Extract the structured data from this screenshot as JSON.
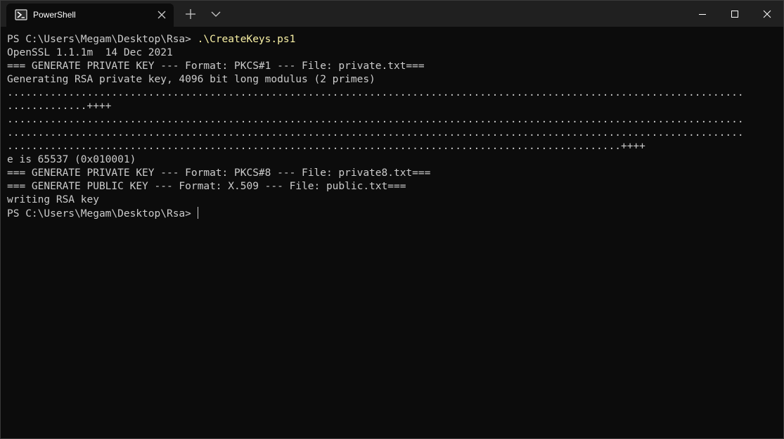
{
  "tab": {
    "icon": "powershell-icon",
    "title": "PowerShell",
    "close_icon": "close-icon"
  },
  "toolbar": {
    "new_tab_icon": "plus-icon",
    "dropdown_icon": "chevron-down-icon"
  },
  "window_controls": {
    "minimize_icon": "minimize-icon",
    "maximize_icon": "maximize-icon",
    "close_icon": "close-icon"
  },
  "colors": {
    "background": "#0c0c0c",
    "titlebar": "#202020",
    "text": "#cccccc",
    "command": "#f9f1a5"
  },
  "terminal": {
    "prompt1": "PS C:\\Users\\Megam\\Desktop\\Rsa> ",
    "command1": ".\\CreateKeys.ps1",
    "output": [
      "OpenSSL 1.1.1m  14 Dec 2021",
      "=== GENERATE PRIVATE KEY --- Format: PKCS#1 --- File: private.txt===",
      "Generating RSA private key, 4096 bit long modulus (2 primes)",
      "........................................................................................................................",
      ".............++++",
      "........................................................................................................................",
      "........................................................................................................................",
      "....................................................................................................++++",
      "e is 65537 (0x010001)",
      "=== GENERATE PRIVATE KEY --- Format: PKCS#8 --- File: private8.txt===",
      "=== GENERATE PUBLIC KEY --- Format: X.509 --- File: public.txt===",
      "writing RSA key"
    ],
    "prompt2": "PS C:\\Users\\Megam\\Desktop\\Rsa> "
  }
}
